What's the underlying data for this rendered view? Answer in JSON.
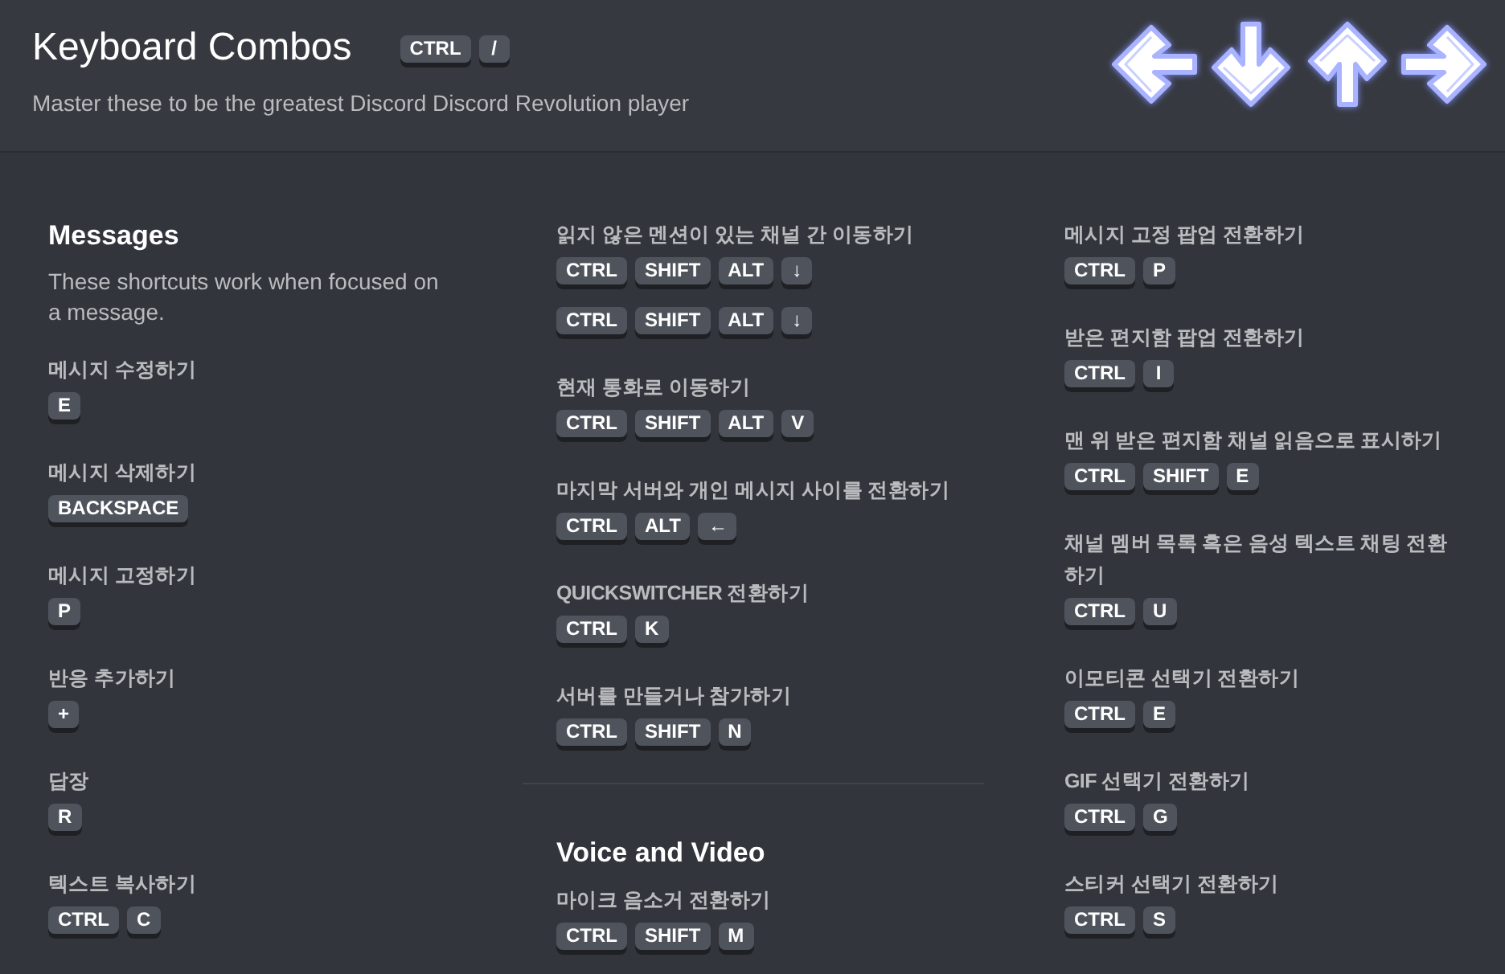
{
  "header": {
    "title": "Keyboard Combos",
    "title_keys": [
      "CTRL",
      "/"
    ],
    "subtitle": "Master these to be the greatest Discord Discord Revolution player"
  },
  "columns": [
    {
      "sections": [
        {
          "heading": "Messages",
          "description": "These shortcuts work when focused on a message.",
          "shortcuts": [
            {
              "label": "메시지 수정하기",
              "combos": [
                [
                  "E"
                ]
              ]
            },
            {
              "label": "메시지 삭제하기",
              "combos": [
                [
                  "BACKSPACE"
                ]
              ]
            },
            {
              "label": "메시지 고정하기",
              "combos": [
                [
                  "P"
                ]
              ]
            },
            {
              "label": "반응 추가하기",
              "combos": [
                [
                  "+"
                ]
              ]
            },
            {
              "label": "답장",
              "combos": [
                [
                  "R"
                ]
              ]
            },
            {
              "label": "텍스트 복사하기",
              "combos": [
                [
                  "CTRL",
                  "C"
                ]
              ]
            }
          ]
        }
      ]
    },
    {
      "sections": [
        {
          "shortcuts": [
            {
              "label": "읽지 않은 멘션이 있는 채널 간 이동하기",
              "combos": [
                [
                  "CTRL",
                  "SHIFT",
                  "ALT",
                  "↓"
                ],
                [
                  "CTRL",
                  "SHIFT",
                  "ALT",
                  "↓"
                ]
              ]
            },
            {
              "label": "현재 통화로 이동하기",
              "combos": [
                [
                  "CTRL",
                  "SHIFT",
                  "ALT",
                  "V"
                ]
              ]
            },
            {
              "label": "마지막 서버와 개인 메시지 사이를 전환하기",
              "combos": [
                [
                  "CTRL",
                  "ALT",
                  "←"
                ]
              ]
            },
            {
              "label": "QUICKSWITCHER 전환하기",
              "combos": [
                [
                  "CTRL",
                  "K"
                ]
              ]
            },
            {
              "label": "서버를 만들거나 참가하기",
              "combos": [
                [
                  "CTRL",
                  "SHIFT",
                  "N"
                ]
              ]
            }
          ]
        },
        {
          "heading": "Voice and Video",
          "shortcuts": [
            {
              "label": "마이크 음소거 전환하기",
              "combos": [
                [
                  "CTRL",
                  "SHIFT",
                  "M"
                ]
              ]
            }
          ]
        }
      ]
    },
    {
      "sections": [
        {
          "shortcuts": [
            {
              "label": "메시지 고정 팝업 전환하기",
              "combos": [
                [
                  "CTRL",
                  "P"
                ]
              ]
            },
            {
              "label": "받은 편지함 팝업 전환하기",
              "combos": [
                [
                  "CTRL",
                  "I"
                ]
              ]
            },
            {
              "label": "맨 위 받은 편지함 채널 읽음으로 표시하기",
              "combos": [
                [
                  "CTRL",
                  "SHIFT",
                  "E"
                ]
              ]
            },
            {
              "label": "채널 멤버 목록 혹은 음성 텍스트 채팅 전환하기",
              "combos": [
                [
                  "CTRL",
                  "U"
                ]
              ]
            },
            {
              "label": "이모티콘 선택기 전환하기",
              "combos": [
                [
                  "CTRL",
                  "E"
                ]
              ]
            },
            {
              "label": "GIF 선택기 전환하기",
              "combos": [
                [
                  "CTRL",
                  "G"
                ]
              ]
            },
            {
              "label": "스티커 선택기 전환하기",
              "combos": [
                [
                  "CTRL",
                  "S"
                ]
              ]
            }
          ]
        }
      ]
    }
  ]
}
